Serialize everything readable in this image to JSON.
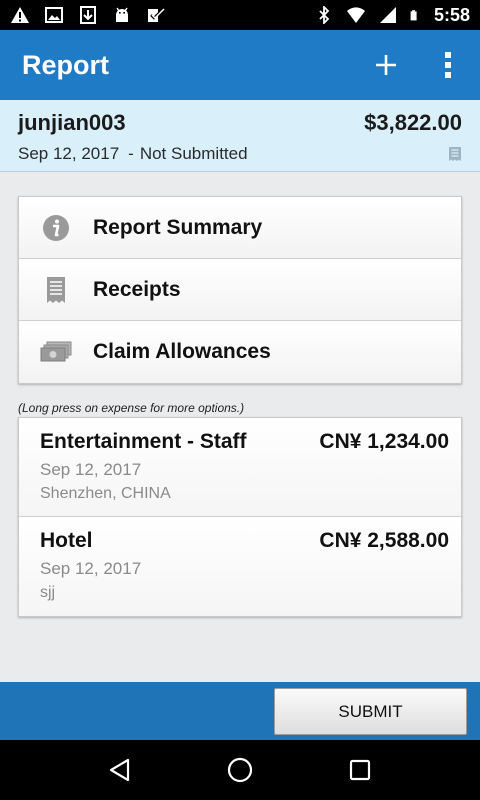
{
  "status_bar": {
    "time": "5:58",
    "left_icons": [
      "warning-icon",
      "image-icon",
      "download-icon",
      "android-icon",
      "checkbox-icon"
    ],
    "right_icons": [
      "bluetooth-icon",
      "wifi-icon",
      "signal-icon",
      "battery-icon"
    ]
  },
  "app_bar": {
    "title": "Report",
    "add_icon": "plus-icon",
    "menu_icon": "overflow-menu-icon",
    "color": "#1f7bc6"
  },
  "report": {
    "name": "junjian003",
    "amount": "$3,822.00",
    "date": "Sep 12, 2017",
    "separator": "-",
    "status": "Not Submitted",
    "background": "#d9effa"
  },
  "menu": {
    "items": [
      {
        "label": "Report Summary",
        "icon": "info-icon"
      },
      {
        "label": "Receipts",
        "icon": "receipt-icon"
      },
      {
        "label": "Claim Allowances",
        "icon": "cash-icon"
      }
    ]
  },
  "hint": "(Long press on expense for more options.)",
  "expenses": [
    {
      "title": "Entertainment - Staff",
      "amount": "CN¥ 1,234.00",
      "date": "Sep 12, 2017",
      "detail": "Shenzhen, CHINA"
    },
    {
      "title": "Hotel",
      "amount": "CN¥ 2,588.00",
      "date": "Sep 12, 2017",
      "detail": "sjj"
    }
  ],
  "bottom_bar": {
    "submit_label": "SUBMIT",
    "color": "#1f74b8"
  },
  "nav_bar": {
    "icons": [
      "back-icon",
      "home-icon",
      "recents-icon"
    ]
  }
}
